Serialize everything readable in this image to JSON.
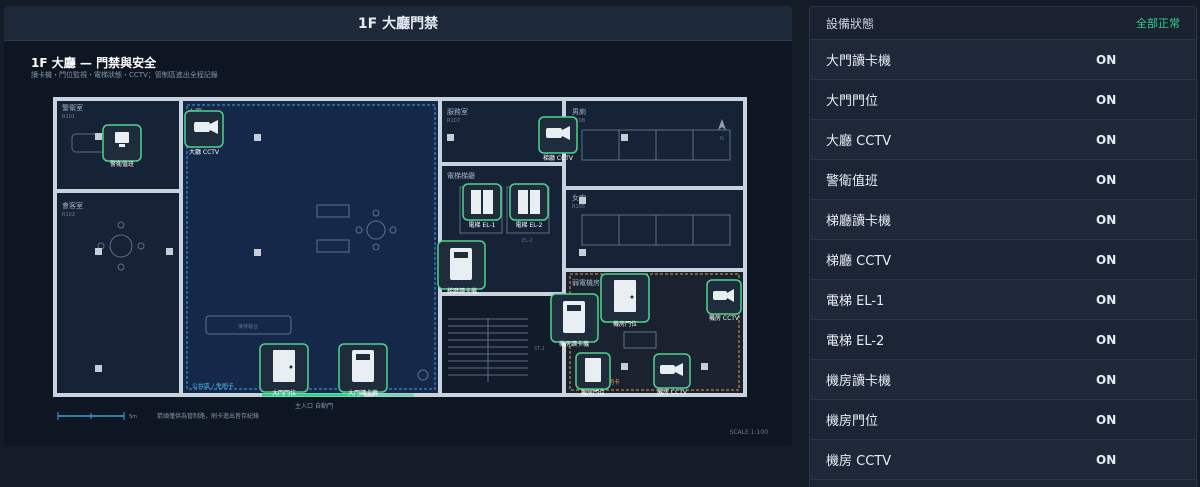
{
  "left": {
    "header": "1F 大廳門禁",
    "plan_title": "1F 大廳 — 門禁與安全",
    "plan_subtitle": "讀卡機・門位監視・電梯狀態・CCTV；管制區進出全程記錄",
    "scale": "SCALE 1:100",
    "scale_bar_label": "5m",
    "footer_note": "箭頭僅供為管制路，刷卡進出皆存紀錄",
    "entrance_label": "主入口 自動門"
  },
  "rooms": {
    "guard": {
      "name": "警衛室",
      "code": "R101"
    },
    "meeting": {
      "name": "會客室",
      "code": "R102"
    },
    "lobby": {
      "name": "大廳",
      "code": "R103"
    },
    "service": {
      "name": "服務室",
      "code": "R107"
    },
    "toilet_m": {
      "name": "男廁",
      "code": "R108"
    },
    "elevator_hall": {
      "name": "電梯梯廳",
      "code": "R104"
    },
    "toilet_f": {
      "name": "女廁",
      "code": "R105"
    },
    "machine_room": {
      "name": "弱電機房",
      "code": "R106"
    },
    "public_zone": "公共區 / 免刷卡",
    "restricted_zone": "管制區 / 需刷卡",
    "reception_desk": "接待櫃台",
    "stairs": "ST-1",
    "el1": "EL-1",
    "el2": "EL-2",
    "north": "N"
  },
  "devices_on_plan": {
    "guard_duty": "警衛值班",
    "lobby_cctv": "大廳 CCTV",
    "service_cctv": "梯廳 CCTV",
    "el1": "電梯 EL-1",
    "el2": "電梯 EL-2",
    "hall_reader": "梯廳讀卡機",
    "main_door": "大門門位",
    "main_reader": "大門讀卡機",
    "machine_reader": "機房讀卡機",
    "machine_door": "機房門位",
    "machine_cctv": "機房 CCTV",
    "machine_door2": "機房門位",
    "machine_cctv2": "機房 CCTV"
  },
  "right": {
    "title": "設備狀態",
    "summary": "全部正常",
    "devices": [
      {
        "name": "大門讀卡機",
        "state": "ON"
      },
      {
        "name": "大門門位",
        "state": "ON"
      },
      {
        "name": "大廳 CCTV",
        "state": "ON"
      },
      {
        "name": "警衛值班",
        "state": "ON"
      },
      {
        "name": "梯廳讀卡機",
        "state": "ON"
      },
      {
        "name": "梯廳 CCTV",
        "state": "ON"
      },
      {
        "name": "電梯 EL-1",
        "state": "ON"
      },
      {
        "name": "電梯 EL-2",
        "state": "ON"
      },
      {
        "name": "機房讀卡機",
        "state": "ON"
      },
      {
        "name": "機房門位",
        "state": "ON"
      },
      {
        "name": "機房 CCTV",
        "state": "ON"
      }
    ]
  },
  "colors": {
    "accent_green": "#2fcf8a",
    "device_border": "#4fd38c",
    "wall": "#c9d3de",
    "lobby_zone": "#3ea0d8",
    "restricted_zone": "#e0a03c"
  }
}
